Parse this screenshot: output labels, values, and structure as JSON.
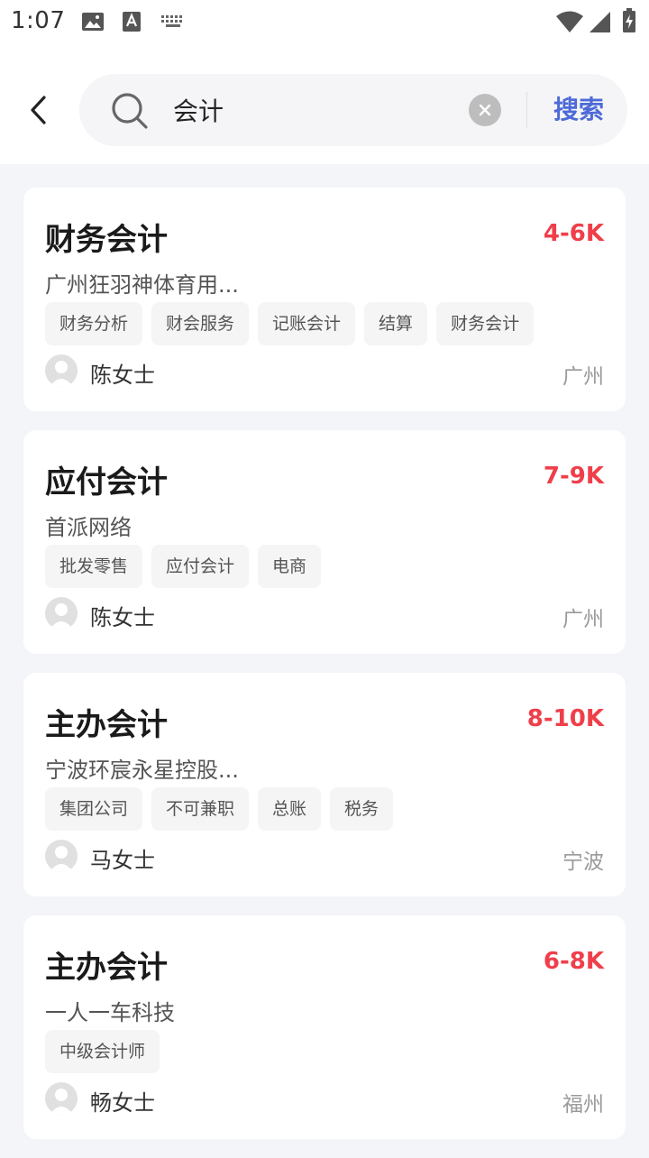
{
  "status_bar": {
    "time": "1:07",
    "icons": [
      "image-icon",
      "text-a-icon",
      "keyboard-icon",
      "wifi-icon",
      "signal-icon",
      "battery-charging-icon"
    ]
  },
  "search": {
    "query": "会计",
    "button_label": "搜索",
    "accent_color": "#4d6ad6",
    "back_icon": "chevron-left-icon",
    "search_icon": "search-icon",
    "clear_icon": "clear-icon"
  },
  "colors": {
    "salary": "#ef3f4a",
    "background": "#f4f5f9",
    "card": "#ffffff",
    "tag_bg": "#f5f5f5"
  },
  "jobs": [
    {
      "title": "财务会计",
      "salary": "4-6K",
      "company": "广州狂羽神体育用...",
      "tags": [
        "财务分析",
        "财会服务",
        "记账会计",
        "结算",
        "财务会计"
      ],
      "recruiter": "陈女士",
      "city": "广州"
    },
    {
      "title": "应付会计",
      "salary": "7-9K",
      "company": "首派网络",
      "tags": [
        "批发零售",
        "应付会计",
        "电商"
      ],
      "recruiter": "陈女士",
      "city": "广州"
    },
    {
      "title": "主办会计",
      "salary": "8-10K",
      "company": "宁波环宸永星控股...",
      "tags": [
        "集团公司",
        "不可兼职",
        "总账",
        "税务"
      ],
      "recruiter": "马女士",
      "city": "宁波"
    },
    {
      "title": "主办会计",
      "salary": "6-8K",
      "company": "一人一车科技",
      "tags": [
        "中级会计师"
      ],
      "recruiter": "畅女士",
      "city": "福州"
    }
  ]
}
